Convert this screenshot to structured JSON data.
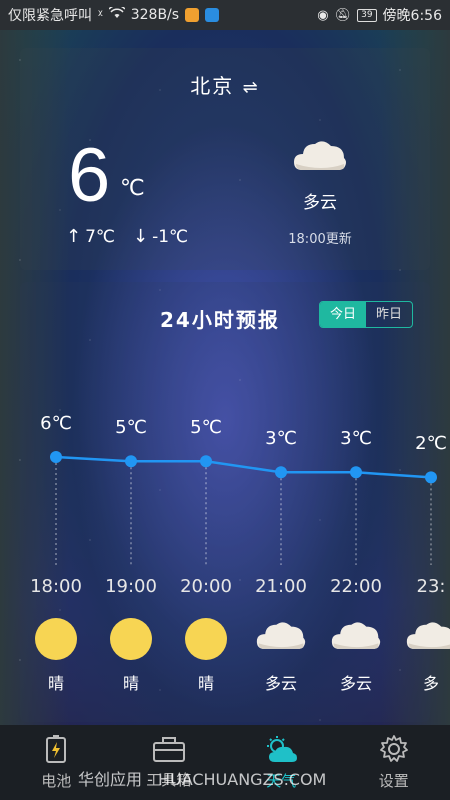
{
  "status_bar": {
    "carrier": "仅限紧急呼叫",
    "speed": "328B/s",
    "battery": "39",
    "time": "傍晚6:56"
  },
  "weather": {
    "city": "北京",
    "switch_icon": "swap-icon",
    "temperature": "6",
    "unit": "℃",
    "high": "7℃",
    "low": "-1℃",
    "condition": "多云",
    "update": "18:00更新"
  },
  "forecast": {
    "title": "24小时预报",
    "tab_today": "今日",
    "tab_yesterday": "昨日",
    "accent": "#1fb8a0",
    "hours": [
      {
        "time": "18:00",
        "temp": "6℃",
        "value": 6,
        "cond": "晴",
        "icon": "sun-icon"
      },
      {
        "time": "19:00",
        "temp": "5℃",
        "value": 5.5,
        "cond": "晴",
        "icon": "sun-icon"
      },
      {
        "time": "20:00",
        "temp": "5℃",
        "value": 5.5,
        "cond": "晴",
        "icon": "sun-icon"
      },
      {
        "time": "21:00",
        "temp": "3℃",
        "value": 4.2,
        "cond": "多云",
        "icon": "cloud-icon"
      },
      {
        "time": "22:00",
        "temp": "3℃",
        "value": 4.2,
        "cond": "多云",
        "icon": "cloud-icon"
      },
      {
        "time": "23:",
        "temp": "2℃",
        "value": 3.6,
        "cond": "多",
        "icon": "cloud-icon"
      }
    ]
  },
  "nav": {
    "items": [
      {
        "label": "电池",
        "icon": "battery-icon"
      },
      {
        "label": "工具箱",
        "icon": "toolbox-icon"
      },
      {
        "label": "天气",
        "icon": "weather-icon"
      },
      {
        "label": "设置",
        "icon": "gear-icon"
      }
    ],
    "watermark": "华创应用 - HUACHUANGZS.COM"
  }
}
